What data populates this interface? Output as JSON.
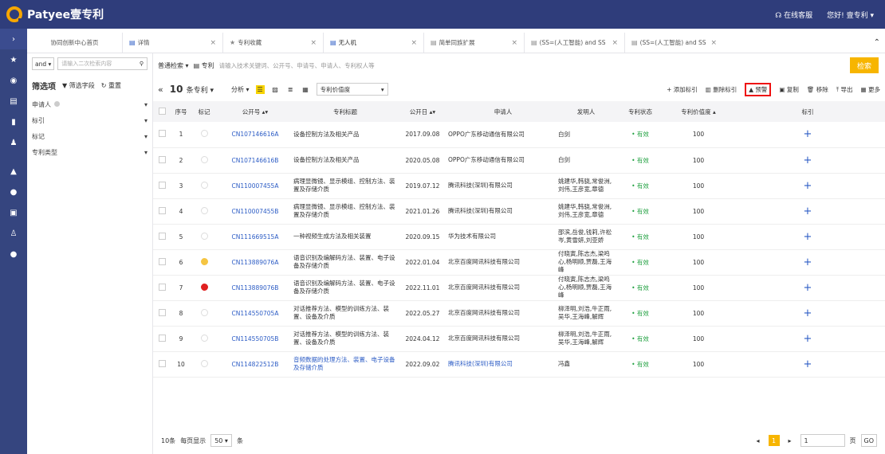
{
  "app": {
    "logo_text": "Patyee壹专利",
    "service": "在线客服",
    "user": "您好! 壹专利 ▾"
  },
  "tabs": [
    {
      "label": "协同创新中心首页",
      "closable": false
    },
    {
      "label": "详情",
      "closable": true
    },
    {
      "label": "专利收藏",
      "closable": true
    },
    {
      "label": "无人机",
      "closable": true,
      "active": true
    },
    {
      "label": "简单同族扩展",
      "closable": true
    },
    {
      "label": "(SS=(人工智能) and SS",
      "closable": true
    },
    {
      "label": "(SS=(人工智能) and SS",
      "closable": true
    }
  ],
  "filter": {
    "op": "and ▾",
    "placeholder": "请输入二次检索内容",
    "title": "筛选项",
    "filter_field": "▼ 筛选字段",
    "reset": "↻ 重置",
    "groups": [
      "申请人",
      "标引",
      "标记",
      "专利类型"
    ]
  },
  "search": {
    "type": "普通检索 ▾",
    "scope": "专利",
    "placeholder": "请输入技术关键词、公开号、申请号、申请人、专利权人等",
    "button": "检索"
  },
  "toolbar": {
    "collapse": "«",
    "count": "10",
    "count_unit": "条专利 ▾",
    "analyze": "分析 ▾",
    "sort": "专利价值度",
    "add_tag": "+ 添加标引",
    "del_tag": "删除标引",
    "warn": "预警",
    "copy": "复制",
    "remove": "移除",
    "export": "导出",
    "more": "更多"
  },
  "table": {
    "headers": [
      "序号",
      "标记",
      "公开号 ▴▾",
      "专利标题",
      "公开日 ▴▾",
      "申请人",
      "发明人",
      "专利状态",
      "专利价值度 ▴",
      "标引"
    ],
    "rows": [
      {
        "no": "1",
        "mark": "none",
        "pn": "CN107146616A",
        "title": "设备控制方法及相关产品",
        "date": "2017.09.08",
        "applicant": "OPPO广东移动通信有限公司",
        "inventor": "白剑",
        "status": "• 有效",
        "value": "100",
        "blue": false
      },
      {
        "no": "2",
        "mark": "none",
        "pn": "CN107146616B",
        "title": "设备控制方法及相关产品",
        "date": "2020.05.08",
        "applicant": "OPPO广东移动通信有限公司",
        "inventor": "白剑",
        "status": "• 有效",
        "value": "100",
        "blue": false
      },
      {
        "no": "3",
        "mark": "none",
        "pn": "CN110007455A",
        "title": "病理显微镜、显示模组、控制方法、装置及存储介质",
        "date": "2019.07.12",
        "applicant": "腾讯科技(深圳)有限公司",
        "inventor": "姚建华,韩骁,常俊洲,刘伟,王彦宽,章德",
        "status": "• 有效",
        "value": "100",
        "blue": false
      },
      {
        "no": "4",
        "mark": "none",
        "pn": "CN110007455B",
        "title": "病理显微镜、显示模组、控制方法、装置及存储介质",
        "date": "2021.01.26",
        "applicant": "腾讯科技(深圳)有限公司",
        "inventor": "姚建华,韩骁,常俊洲,刘伟,王彦宽,章德",
        "status": "• 有效",
        "value": "100",
        "blue": false
      },
      {
        "no": "5",
        "mark": "none",
        "pn": "CN111669515A",
        "title": "一种视频生成方法及相关装置",
        "date": "2020.09.15",
        "applicant": "华为技术有限公司",
        "inventor": "邵滨,岳俊,钱莉,许松岑,黄雪妍,刘亚娇",
        "status": "• 有效",
        "value": "100",
        "blue": false
      },
      {
        "no": "6",
        "mark": "yellow",
        "pn": "CN113889076A",
        "title": "语音识别及编解码方法、装置、电子设备及存储介质",
        "date": "2022.01.04",
        "applicant": "北京百度网讯科技有限公司",
        "inventor": "付晓寅,陈志杰,梁鸣心,杨明顺,贾磊,王海峰",
        "status": "• 有效",
        "value": "100",
        "blue": false
      },
      {
        "no": "7",
        "mark": "red",
        "pn": "CN113889076B",
        "title": "语音识别及编解码方法、装置、电子设备及存储介质",
        "date": "2022.11.01",
        "applicant": "北京百度网讯科技有限公司",
        "inventor": "付晓寅,陈志杰,梁鸣心,杨明顺,贾磊,王海峰",
        "status": "• 有效",
        "value": "100",
        "blue": false
      },
      {
        "no": "8",
        "mark": "none",
        "pn": "CN114550705A",
        "title": "对话推荐方法、模型的训练方法、装置、设备及介质",
        "date": "2022.05.27",
        "applicant": "北京百度网讯科技有限公司",
        "inventor": "柳泽明,刘浩,牛正雨,吴华,王海峰,解辉",
        "status": "• 有效",
        "value": "100",
        "blue": false
      },
      {
        "no": "9",
        "mark": "none",
        "pn": "CN114550705B",
        "title": "对话推荐方法、模型的训练方法、装置、设备及介质",
        "date": "2024.04.12",
        "applicant": "北京百度网讯科技有限公司",
        "inventor": "柳泽明,刘浩,牛正雨,吴华,王海峰,解辉",
        "status": "• 有效",
        "value": "100",
        "blue": false
      },
      {
        "no": "10",
        "mark": "none",
        "pn": "CN114822512B",
        "title": "音频数据的处理方法、装置、电子设备及存储介质",
        "date": "2022.09.02",
        "applicant": "腾讯科技(深圳)有限公司",
        "inventor": "冯鑫",
        "status": "• 有效",
        "value": "100",
        "blue": true
      }
    ]
  },
  "footer": {
    "total": "10条",
    "per_page_label": "每页显示",
    "per_page": "50 ▾",
    "unit": "条",
    "current_page": "1",
    "page_input": "1",
    "page_unit": "页",
    "go": "GO"
  }
}
